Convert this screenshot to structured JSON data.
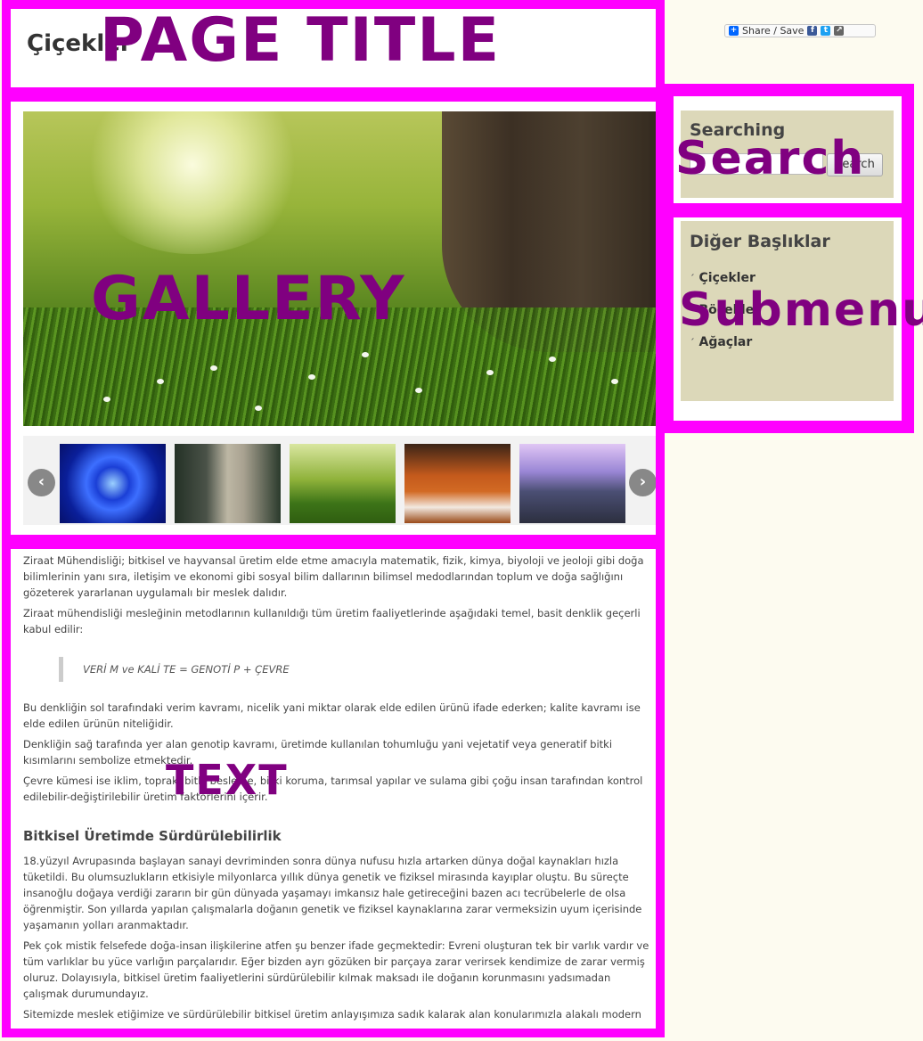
{
  "header": {
    "site_title": "Çiçekler"
  },
  "overlay_labels": {
    "page_title": "PAGE TITLE",
    "gallery": "GALLERY",
    "search": "Search",
    "submenu": "Submenu",
    "text": "TEXT"
  },
  "share": {
    "label": "Share / Save"
  },
  "gallery": {
    "thumbnails": [
      "water-drop",
      "stone-statue",
      "meadow",
      "drums",
      "glass-building"
    ]
  },
  "search": {
    "heading": "Searching",
    "input_value": "",
    "button_label": "Search"
  },
  "submenu": {
    "heading": "Diğer Başlıklar",
    "items": [
      "Çiçekler",
      "Böcekler",
      "Ağaçlar"
    ]
  },
  "content": {
    "p1": "Ziraat Mühendisliği; bitkisel ve hayvansal üretim elde etme amacıyla matematik, fizik, kimya, biyoloji ve  jeoloji gibi doğa",
    "p1b": "bilimlerinin yanı sıra, iletişim ve ekonomi gibi sosyal bilim dallarının bilimsel medodlarından toplum ve doğa  sağlığını",
    "p1c": "gözeterek yararlanan uygulamalı bir meslek dalıdır.",
    "p2": "Ziraat mühendisliği mesleğinin metodlarının kullanıldığı tüm üretim faaliyetlerinde aşağıdaki  temel, basit denklik geçerli",
    "p2b": "kabul edilir:",
    "quote": "VERİ M ve KALİ TE = GENOTİ P + ÇEVRE",
    "p3": "Bu denkliğin sol tarafındaki verim kavramı, nicelik yani miktar olarak elde edilen ürünü ifade ederken; kalite kavramı ise",
    "p3b": "elde edilen ürünün niteliğidir.",
    "p4": "Denkliğin  sağ  tarafında  yer  alan  genotip  kavramı,  üretimde  kullanılan  tohumluğu  yani  vejetatif  veya  generatif  bitki",
    "p4b": "kısımlarını sembolize etmektedir.",
    "p5": "Çevre kümesi ise iklim, toprak, bitki besleme, bitki koruma, tarımsal yapılar ve sulama gibi çoğu insan tarafından kontrol",
    "p5b": "edilebilir-değiştirilebilir üretim faktörlerini içerir.",
    "heading": "Bitkisel Üretimde Sürdürülebilirlik",
    "p6": "18.yüzyıl Avrupasında başlayan sanayi devriminden sonra dünya nufusu hızla artarken dünya doğal kaynakları hızla",
    "p6b": "tüketildi. Bu olumsuzlukların  etkisiyle milyonlarca yıllık dünya genetik ve fiziksel mirasında kayıplar oluştu. Bu süreçte",
    "p6c": "insanoğlu doğaya verdiği zararın bir gün dünyada yaşamayı imkansız hale getireceğini bazen acı tecrübelerle de olsa",
    "p6d": "öğrenmiştir. Son yıllarda yapılan çalışmalarla doğanın genetik ve fiziksel kaynaklarına zarar vermeksizin uyum içerisinde",
    "p6e": "yaşamanın yolları aranmaktadır.",
    "p7": "Pek çok mistik felsefede doğa-insan ilişkilerine atfen şu benzer ifade geçmektedir: Evreni oluşturan tek bir varlık vardır ve",
    "p7b": "tüm varlıklar bu yüce varlığın parçalarıdır. Eğer bizden ayrı gözüken bir parçaya zarar verirsek kendimize de zarar vermiş",
    "p7c": "oluruz.  Dolayısıyla,  bitkisel  üretim  faaliyetlerini  sürdürülebilir  kılmak  maksadı  ile  doğanın  korunmasını  yadsımadan",
    "p7d": "çalışmak durumundayız.",
    "p8": "Sitemizde meslek etiğimize ve sürdürülebilir bitkisel üretim anlayışımıza sadık kalarak  alan konularımızla alakalı modern"
  }
}
